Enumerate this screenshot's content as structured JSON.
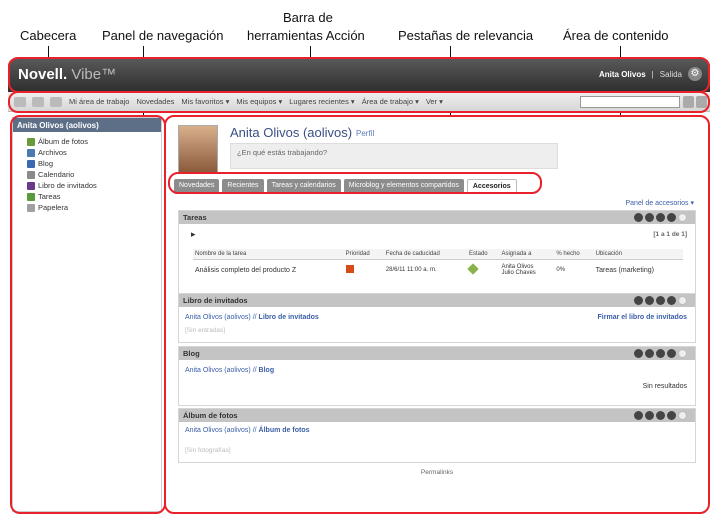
{
  "callouts": {
    "cabecera": "Cabecera",
    "panel": "Panel de navegación",
    "barra_1": "Barra de",
    "barra_2": "herramientas Acción",
    "pestanas": "Pestañas de relevancia",
    "area": "Área de contenido"
  },
  "header": {
    "brand": "Novell.",
    "brand2": "Vibe™",
    "user": "Anita Olivos",
    "separator": "|",
    "logout": "Salida"
  },
  "toolbar": {
    "items": [
      "Mi área de trabajo",
      "Novedades",
      "Mis favoritos ▾",
      "Mis equipos ▾",
      "Lugares recientes ▾",
      "Área de trabajo ▾",
      "Ver ▾"
    ]
  },
  "sidebar": {
    "title": "Anita Olivos (aolivos)",
    "items": [
      "Álbum de fotos",
      "Archivos",
      "Blog",
      "Calendario",
      "Libro de invitados",
      "Tareas",
      "Papelera"
    ],
    "colors": [
      "#6a9a3a",
      "#4a7ab0",
      "#3a6ab0",
      "#8a8a8a",
      "#6a3a8a",
      "#5a9a3a",
      "#a0a0a0"
    ]
  },
  "profile": {
    "name": "Anita Olivos (aolivos)",
    "perfil": "Perfil",
    "status_placeholder": "¿En qué estás trabajando?"
  },
  "tabs": [
    "Novedades",
    "Recientes",
    "Tareas y calendarios",
    "Microblog y elementos compartidos",
    "Accesorios"
  ],
  "accessory_panel": "Panel de accesorios ▾",
  "tareas": {
    "title": "Tareas",
    "paging": "[1 a 1 de 1]",
    "headers": [
      "Nombre de la tarea",
      "Prioridad",
      "Fecha de caducidad",
      "Estado",
      "Asignada a",
      "% hecho",
      "Ubicación"
    ],
    "row": {
      "name": "Análisis completo del producto Z",
      "date": "28/6/11 11:00 a. m.",
      "assigned1": "Anita Olivos",
      "assigned2": "Julio Chaves",
      "pct": "0%",
      "loc": "Tareas (marketing)"
    }
  },
  "libro": {
    "title": "Libro de invitados",
    "link_pre": "Anita Olivos (aolivos) //",
    "link_bold": "Libro de invitados",
    "sign": "Firmar el libro de invitados",
    "none": "[Sin entradas]"
  },
  "blog": {
    "title": "Blog",
    "link_pre": "Anita Olivos (aolivos) //",
    "link_bold": "Blog",
    "none": "Sin resultados"
  },
  "album": {
    "title": "Álbum de fotos",
    "link_pre": "Anita Olivos (aolivos) //",
    "link_bold": "Álbum de fotos",
    "none": "[Sin fotografías]"
  },
  "permalink": "Permalinks"
}
